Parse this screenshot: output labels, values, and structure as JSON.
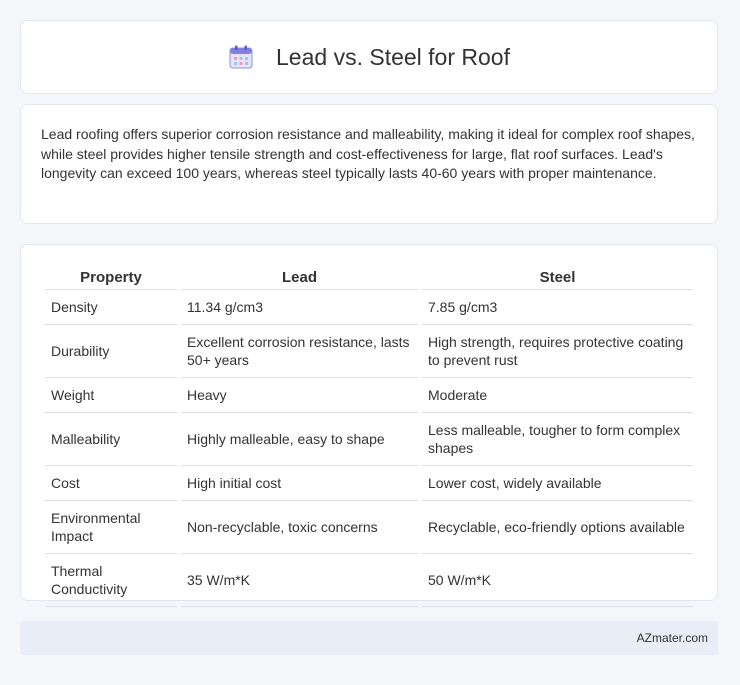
{
  "header": {
    "title": "Lead vs. Steel for Roof",
    "icon": "calendar-icon"
  },
  "summary": {
    "text": "Lead roofing offers superior corrosion resistance and malleability, making it ideal for complex roof shapes, while steel provides higher tensile strength and cost-effectiveness for large, flat roof surfaces. Lead's longevity can exceed 100 years, whereas steel typically lasts 40-60 years with proper maintenance."
  },
  "table": {
    "headers": [
      "Property",
      "Lead",
      "Steel"
    ],
    "rows": [
      [
        "Density",
        "11.34 g/cm3",
        "7.85 g/cm3"
      ],
      [
        "Durability",
        "Excellent corrosion resistance, lasts 50+ years",
        "High strength, requires protective coating to prevent rust"
      ],
      [
        "Weight",
        "Heavy",
        "Moderate"
      ],
      [
        "Malleability",
        "Highly malleable, easy to shape",
        "Less malleable, tougher to form complex shapes"
      ],
      [
        "Cost",
        "High initial cost",
        "Lower cost, widely available"
      ],
      [
        "Environmental Impact",
        "Non-recyclable, toxic concerns",
        "Recyclable, eco-friendly options available"
      ],
      [
        "Thermal Conductivity",
        "35 W/m*K",
        "50 W/m*K"
      ]
    ]
  },
  "footer": {
    "brand": "AZmater.com"
  }
}
